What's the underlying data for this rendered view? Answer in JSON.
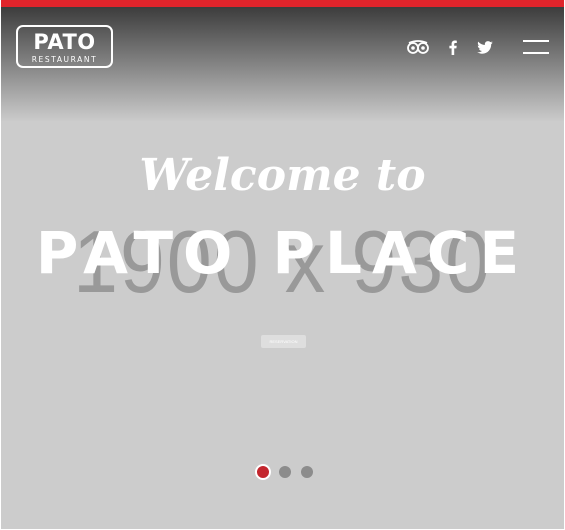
{
  "header": {
    "logo": {
      "name": "PATO",
      "subtitle": "RESTAURANT"
    },
    "social": [
      {
        "icon": "tripadvisor-icon"
      },
      {
        "icon": "facebook-icon"
      },
      {
        "icon": "twitter-icon"
      }
    ],
    "menu_icon": "hamburger-menu-icon",
    "accent_color": "#e0242b"
  },
  "hero": {
    "placeholder_text": "1900 x 930",
    "welcome": "Welcome to",
    "title": "PATO PLACE",
    "button_label": "RESERVATION",
    "background_color": "#cccccc"
  },
  "slider": {
    "total_slides": 3,
    "active_slide": 1,
    "active_color": "#c3262e",
    "inactive_color": "#8c8c8c"
  }
}
